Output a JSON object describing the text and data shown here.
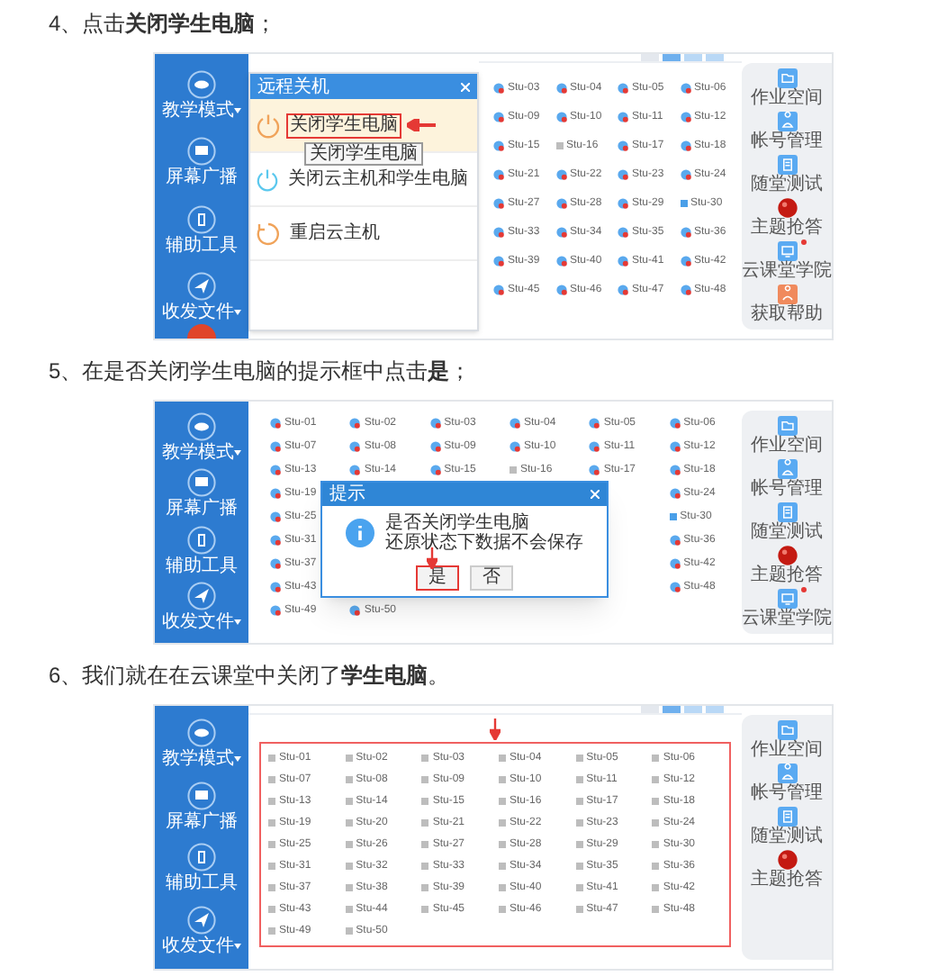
{
  "steps": [
    {
      "heading": "4、点击**关闭学生电脑**；",
      "screen": {
        "kind": "menu",
        "sidebar": [
          {
            "label": "教学模式",
            "dropdown": true
          },
          {
            "label": "屏幕广播",
            "dropdown": false
          },
          {
            "label": "辅助工具",
            "dropdown": false
          },
          {
            "label": "收发文件",
            "dropdown": true
          }
        ],
        "power_button": true,
        "menu": {
          "title": "远程关机",
          "items": [
            {
              "label": "关闭学生电脑",
              "kind": "power",
              "selected": true
            },
            {
              "label": "关闭云主机和学生电脑",
              "kind": "power-cloud",
              "selected": false
            },
            {
              "label": "重启云主机",
              "kind": "restart",
              "selected": false
            }
          ],
          "tooltip": "关闭学生电脑"
        },
        "students": [
          {
            "label": "Stu-03",
            "kind": "alert"
          },
          {
            "label": "Stu-04",
            "kind": "alert"
          },
          {
            "label": "Stu-05",
            "kind": "alert"
          },
          {
            "label": "Stu-06",
            "kind": "alert"
          },
          {
            "label": "Stu-09",
            "kind": "alert"
          },
          {
            "label": "Stu-10",
            "kind": "alert"
          },
          {
            "label": "Stu-11",
            "kind": "alert"
          },
          {
            "label": "Stu-12",
            "kind": "alert"
          },
          {
            "label": "Stu-15",
            "kind": "alert"
          },
          {
            "label": "Stu-16",
            "kind": "offline"
          },
          {
            "label": "Stu-17",
            "kind": "alert"
          },
          {
            "label": "Stu-18",
            "kind": "alert"
          },
          {
            "label": "Stu-21",
            "kind": "alert"
          },
          {
            "label": "Stu-22",
            "kind": "alert"
          },
          {
            "label": "Stu-23",
            "kind": "alert"
          },
          {
            "label": "Stu-24",
            "kind": "alert"
          },
          {
            "label": "Stu-27",
            "kind": "alert"
          },
          {
            "label": "Stu-28",
            "kind": "alert"
          },
          {
            "label": "Stu-29",
            "kind": "alert"
          },
          {
            "label": "Stu-30",
            "kind": "active"
          },
          {
            "label": "Stu-33",
            "kind": "alert"
          },
          {
            "label": "Stu-34",
            "kind": "alert"
          },
          {
            "label": "Stu-35",
            "kind": "alert"
          },
          {
            "label": "Stu-36",
            "kind": "alert"
          },
          {
            "label": "Stu-39",
            "kind": "alert"
          },
          {
            "label": "Stu-40",
            "kind": "alert"
          },
          {
            "label": "Stu-41",
            "kind": "alert"
          },
          {
            "label": "Stu-42",
            "kind": "alert"
          },
          {
            "label": "Stu-45",
            "kind": "alert"
          },
          {
            "label": "Stu-46",
            "kind": "alert"
          },
          {
            "label": "Stu-47",
            "kind": "alert"
          },
          {
            "label": "Stu-48",
            "kind": "alert"
          }
        ],
        "right_panel": [
          {
            "label": "作业空间",
            "kind": "folder",
            "badge": false
          },
          {
            "label": "帐号管理",
            "kind": "user",
            "badge": false
          },
          {
            "label": "随堂测试",
            "kind": "document",
            "badge": false
          },
          {
            "label": "主题抢答",
            "kind": "ball",
            "badge": false
          },
          {
            "label": "云课堂学院",
            "kind": "screen",
            "badge": true
          },
          {
            "label": "获取帮助",
            "kind": "help",
            "badge": false
          }
        ]
      }
    },
    {
      "heading": "5、在是否关闭学生电脑的提示框中点击**是**；",
      "screen": {
        "kind": "dialog",
        "sidebar": [
          {
            "label": "教学模式",
            "dropdown": true
          },
          {
            "label": "屏幕广播",
            "dropdown": false
          },
          {
            "label": "辅助工具",
            "dropdown": false
          },
          {
            "label": "收发文件",
            "dropdown": true
          }
        ],
        "power_button": false,
        "dialog": {
          "title": "提示",
          "lines": [
            "是否关闭学生电脑",
            "还原状态下数据不会保存"
          ],
          "buttons": [
            {
              "label": "是",
              "selected": true
            },
            {
              "label": "否",
              "selected": false
            }
          ]
        },
        "students": [
          {
            "label": "Stu-01",
            "kind": "alert"
          },
          {
            "label": "Stu-02",
            "kind": "alert"
          },
          {
            "label": "Stu-03",
            "kind": "alert"
          },
          {
            "label": "Stu-04",
            "kind": "alert"
          },
          {
            "label": "Stu-05",
            "kind": "alert"
          },
          {
            "label": "Stu-06",
            "kind": "alert"
          },
          {
            "label": "Stu-07",
            "kind": "alert"
          },
          {
            "label": "Stu-08",
            "kind": "alert"
          },
          {
            "label": "Stu-09",
            "kind": "alert"
          },
          {
            "label": "Stu-10",
            "kind": "alert"
          },
          {
            "label": "Stu-11",
            "kind": "alert"
          },
          {
            "label": "Stu-12",
            "kind": "alert"
          },
          {
            "label": "Stu-13",
            "kind": "alert"
          },
          {
            "label": "Stu-14",
            "kind": "alert"
          },
          {
            "label": "Stu-15",
            "kind": "alert"
          },
          {
            "label": "Stu-16",
            "kind": "offline"
          },
          {
            "label": "Stu-17",
            "kind": "alert"
          },
          {
            "label": "Stu-18",
            "kind": "alert"
          },
          {
            "label": "Stu-19",
            "kind": "alert"
          },
          {
            "kind": "covered"
          },
          {
            "kind": "covered"
          },
          {
            "kind": "covered"
          },
          {
            "kind": "covered"
          },
          {
            "label": "Stu-24",
            "kind": "alert"
          },
          {
            "label": "Stu-25",
            "kind": "alert"
          },
          {
            "kind": "covered"
          },
          {
            "kind": "covered"
          },
          {
            "kind": "covered"
          },
          {
            "kind": "covered"
          },
          {
            "label": "Stu-30",
            "kind": "active"
          },
          {
            "label": "Stu-31",
            "kind": "alert"
          },
          {
            "kind": "covered"
          },
          {
            "kind": "covered"
          },
          {
            "kind": "covered"
          },
          {
            "kind": "covered"
          },
          {
            "label": "Stu-36",
            "kind": "alert"
          },
          {
            "label": "Stu-37",
            "kind": "alert"
          },
          {
            "kind": "covered"
          },
          {
            "kind": "covered"
          },
          {
            "kind": "covered"
          },
          {
            "kind": "covered"
          },
          {
            "label": "Stu-42",
            "kind": "alert"
          },
          {
            "label": "Stu-43",
            "kind": "alert"
          },
          {
            "kind": "covered"
          },
          {
            "kind": "covered"
          },
          {
            "kind": "covered"
          },
          {
            "kind": "covered"
          },
          {
            "label": "Stu-48",
            "kind": "alert"
          },
          {
            "label": "Stu-49",
            "kind": "alert"
          },
          {
            "label": "Stu-50",
            "kind": "alert"
          }
        ],
        "right_panel": [
          {
            "label": "作业空间",
            "kind": "folder",
            "badge": false
          },
          {
            "label": "帐号管理",
            "kind": "user",
            "badge": false
          },
          {
            "label": "随堂测试",
            "kind": "document",
            "badge": false
          },
          {
            "label": "主题抢答",
            "kind": "ball",
            "badge": false
          },
          {
            "label": "云课堂学院",
            "kind": "screen",
            "badge": true
          }
        ]
      }
    },
    {
      "heading": "6、我们就在在云课堂中关闭了**学生电脑**。",
      "screen": {
        "kind": "grid",
        "sidebar": [
          {
            "label": "教学模式",
            "dropdown": true
          },
          {
            "label": "屏幕广播",
            "dropdown": false
          },
          {
            "label": "辅助工具",
            "dropdown": false
          },
          {
            "label": "收发文件",
            "dropdown": true
          }
        ],
        "power_button": false,
        "highlight_border": true,
        "students": [
          {
            "label": "Stu-01",
            "kind": "offline"
          },
          {
            "label": "Stu-02",
            "kind": "offline"
          },
          {
            "label": "Stu-03",
            "kind": "offline"
          },
          {
            "label": "Stu-04",
            "kind": "offline"
          },
          {
            "label": "Stu-05",
            "kind": "offline"
          },
          {
            "label": "Stu-06",
            "kind": "offline"
          },
          {
            "label": "Stu-07",
            "kind": "offline"
          },
          {
            "label": "Stu-08",
            "kind": "offline"
          },
          {
            "label": "Stu-09",
            "kind": "offline"
          },
          {
            "label": "Stu-10",
            "kind": "offline"
          },
          {
            "label": "Stu-11",
            "kind": "offline"
          },
          {
            "label": "Stu-12",
            "kind": "offline"
          },
          {
            "label": "Stu-13",
            "kind": "offline"
          },
          {
            "label": "Stu-14",
            "kind": "offline"
          },
          {
            "label": "Stu-15",
            "kind": "offline"
          },
          {
            "label": "Stu-16",
            "kind": "offline"
          },
          {
            "label": "Stu-17",
            "kind": "offline"
          },
          {
            "label": "Stu-18",
            "kind": "offline"
          },
          {
            "label": "Stu-19",
            "kind": "offline"
          },
          {
            "label": "Stu-20",
            "kind": "offline"
          },
          {
            "label": "Stu-21",
            "kind": "offline"
          },
          {
            "label": "Stu-22",
            "kind": "offline"
          },
          {
            "label": "Stu-23",
            "kind": "offline"
          },
          {
            "label": "Stu-24",
            "kind": "offline"
          },
          {
            "label": "Stu-25",
            "kind": "offline"
          },
          {
            "label": "Stu-26",
            "kind": "offline"
          },
          {
            "label": "Stu-27",
            "kind": "offline"
          },
          {
            "label": "Stu-28",
            "kind": "offline"
          },
          {
            "label": "Stu-29",
            "kind": "offline"
          },
          {
            "label": "Stu-30",
            "kind": "offline"
          },
          {
            "label": "Stu-31",
            "kind": "offline"
          },
          {
            "label": "Stu-32",
            "kind": "offline"
          },
          {
            "label": "Stu-33",
            "kind": "offline"
          },
          {
            "label": "Stu-34",
            "kind": "offline"
          },
          {
            "label": "Stu-35",
            "kind": "offline"
          },
          {
            "label": "Stu-36",
            "kind": "offline"
          },
          {
            "label": "Stu-37",
            "kind": "offline"
          },
          {
            "label": "Stu-38",
            "kind": "offline"
          },
          {
            "label": "Stu-39",
            "kind": "offline"
          },
          {
            "label": "Stu-40",
            "kind": "offline"
          },
          {
            "label": "Stu-41",
            "kind": "offline"
          },
          {
            "label": "Stu-42",
            "kind": "offline"
          },
          {
            "label": "Stu-43",
            "kind": "offline"
          },
          {
            "label": "Stu-44",
            "kind": "offline"
          },
          {
            "label": "Stu-45",
            "kind": "offline"
          },
          {
            "label": "Stu-46",
            "kind": "offline"
          },
          {
            "label": "Stu-47",
            "kind": "offline"
          },
          {
            "label": "Stu-48",
            "kind": "offline"
          },
          {
            "label": "Stu-49",
            "kind": "offline"
          },
          {
            "label": "Stu-50",
            "kind": "offline"
          }
        ],
        "right_panel": [
          {
            "label": "作业空间",
            "kind": "folder",
            "badge": false
          },
          {
            "label": "帐号管理",
            "kind": "user",
            "badge": false
          },
          {
            "label": "随堂测试",
            "kind": "document",
            "badge": false
          },
          {
            "label": "主题抢答",
            "kind": "ball",
            "badge": false
          }
        ]
      }
    }
  ]
}
